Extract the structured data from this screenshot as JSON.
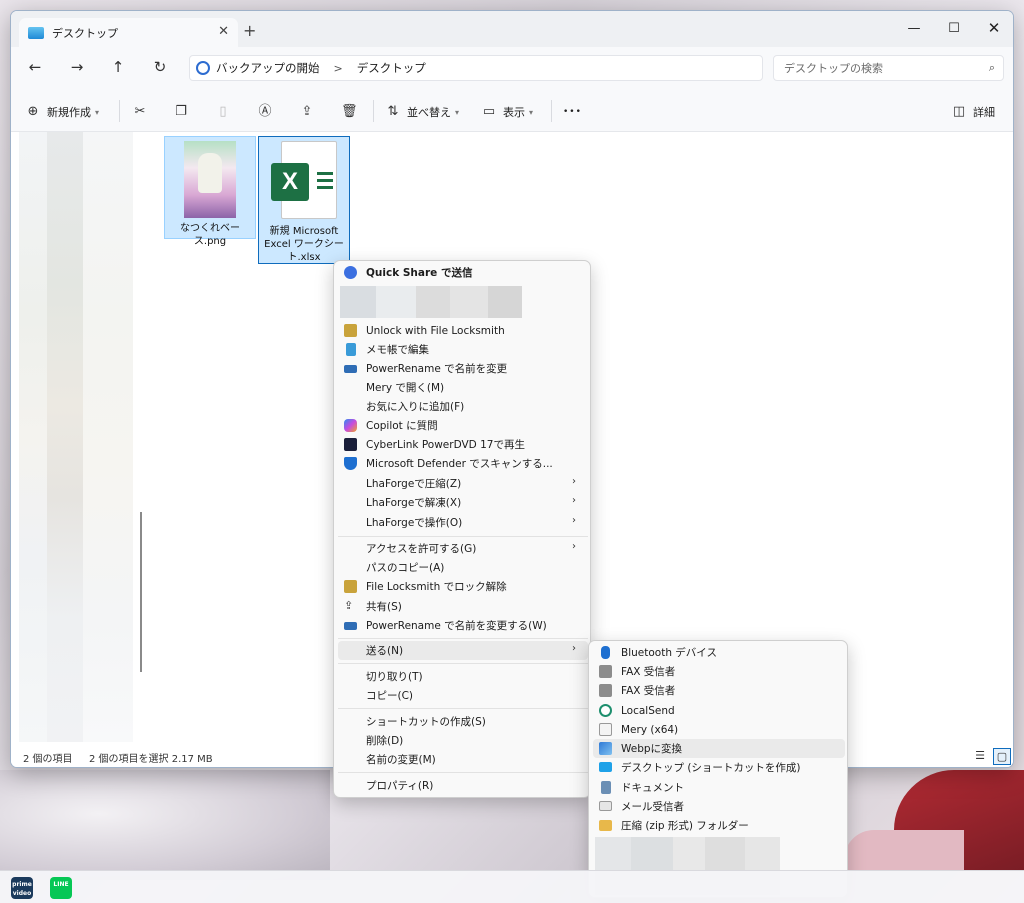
{
  "window": {
    "tab_title": "デスクトップ",
    "tab_close": "✕",
    "new_tab": "+",
    "minimize": "—",
    "maximize": "☐",
    "close": "✕"
  },
  "nav": {
    "back": "←",
    "forward": "→",
    "up": "↑",
    "refresh": "↻"
  },
  "address": {
    "crumbs": [
      "バックアップの開始",
      "デスクトップ"
    ],
    "separator": ">"
  },
  "search": {
    "placeholder": "デスクトップの検索",
    "icon": "⌕"
  },
  "toolbar": {
    "new_label": "新規作成",
    "sort_label": "並べ替え",
    "view_label": "表示",
    "more_label": "•••",
    "details_label": "詳細"
  },
  "files": [
    {
      "name": "なつくれベース.png",
      "selected": true
    },
    {
      "name": "新規 Microsoft Excel ワークシート.xlsx",
      "selected": true,
      "badge": "X"
    }
  ],
  "status": {
    "item_count": "2 個の項目",
    "selected": "2 個の項目を選択 2.17 MB"
  },
  "context_menu": {
    "items": [
      {
        "label": "Quick Share で送信",
        "icon": "quick-share-icon"
      },
      {
        "label": "Unlock with File Locksmith",
        "icon": "lock-icon"
      },
      {
        "label": "メモ帳で編集",
        "icon": "notepad-icon"
      },
      {
        "label": "PowerRename で名前を変更",
        "icon": "power-rename-icon"
      },
      {
        "label": "Mery で開く(M)",
        "icon": ""
      },
      {
        "label": "お気に入りに追加(F)",
        "icon": ""
      },
      {
        "label": "Copilot に質問",
        "icon": "copilot-icon"
      },
      {
        "label": "CyberLink PowerDVD 17で再生",
        "icon": "powerdvd-icon"
      },
      {
        "label": "Microsoft Defender でスキャンする...",
        "icon": "defender-icon"
      },
      {
        "label": "LhaForgeで圧縮(Z)",
        "icon": ""
      },
      {
        "label": "LhaForgeで解凍(X)",
        "icon": ""
      },
      {
        "label": "LhaForgeで操作(O)",
        "icon": ""
      },
      {
        "label": "アクセスを許可する(G)",
        "icon": ""
      },
      {
        "label": "パスのコピー(A)",
        "icon": ""
      },
      {
        "label": "File Locksmith でロック解除",
        "icon": "lock-icon"
      },
      {
        "label": "共有(S)",
        "icon": "share-icon"
      },
      {
        "label": "PowerRename で名前を変更する(W)",
        "icon": "power-rename-icon"
      },
      {
        "label": "送る(N)",
        "icon": ""
      },
      {
        "label": "切り取り(T)",
        "icon": ""
      },
      {
        "label": "コピー(C)",
        "icon": ""
      },
      {
        "label": "ショートカットの作成(S)",
        "icon": ""
      },
      {
        "label": "削除(D)",
        "icon": ""
      },
      {
        "label": "名前の変更(M)",
        "icon": ""
      },
      {
        "label": "プロパティ(R)",
        "icon": ""
      }
    ]
  },
  "send_to": {
    "items": [
      {
        "label": "Bluetooth デバイス",
        "icon": "bluetooth-icon"
      },
      {
        "label": "FAX 受信者",
        "icon": "fax-icon"
      },
      {
        "label": "FAX 受信者",
        "icon": "fax-icon"
      },
      {
        "label": "LocalSend",
        "icon": "localsend-icon"
      },
      {
        "label": "Mery (x64)",
        "icon": "mery-icon"
      },
      {
        "label": "Webpに変換",
        "icon": "image-icon"
      },
      {
        "label": "デスクトップ (ショートカットを作成)",
        "icon": "desktop-icon"
      },
      {
        "label": "ドキュメント",
        "icon": "document-icon"
      },
      {
        "label": "メール受信者",
        "icon": "mail-icon"
      },
      {
        "label": "圧縮 (zip 形式) フォルダー",
        "icon": "zip-folder-icon"
      }
    ]
  },
  "taskbar": {
    "prime_label": "prime video",
    "line_label": "LINE"
  },
  "colors": {
    "accent": "#0f6cbd",
    "selection": "#cce8ff",
    "excel_green": "#1d7044",
    "menu_bg": "#f9f9f9"
  }
}
